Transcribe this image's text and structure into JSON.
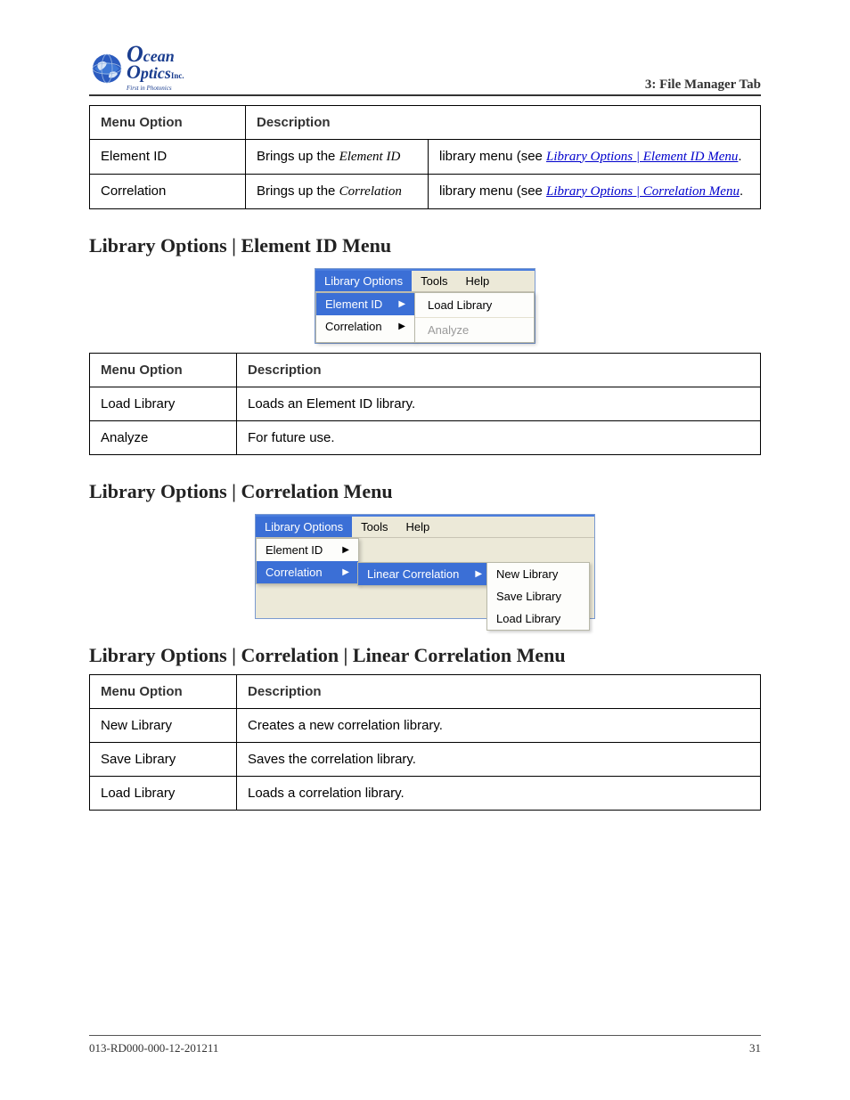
{
  "header": {
    "logo_l1": "cean",
    "logo_l2": "ptics",
    "logo_l3": "First in Photonics",
    "right": "3: File Manager Tab"
  },
  "table1": {
    "head": {
      "c1": "Menu Option",
      "c2": "Description"
    },
    "rows": [
      {
        "opt": "Element ID",
        "d1": "Brings up the ",
        "d_em": "Element ID",
        "d2": " library menu (see ",
        "link": "Library Options | Element ID Menu",
        "d3": "."
      },
      {
        "opt": "Correlation",
        "d1": "Brings up the ",
        "d_em": "Correlation",
        "d2": " library menu (see ",
        "link": "Library Options | Correlation Menu",
        "d3": "."
      }
    ]
  },
  "section1_title": "Library Options | Element ID Menu",
  "fig1": {
    "menubar": [
      "Library Options",
      "Tools",
      "Help"
    ],
    "col1": [
      {
        "label": "Element  ID",
        "sel": true
      },
      {
        "label": "Correlation",
        "sel": false
      }
    ],
    "col2": [
      {
        "label": "Load Library",
        "disabled": false
      },
      {
        "label": "Analyze",
        "disabled": true
      }
    ]
  },
  "table2": {
    "head": {
      "c1": "Menu Option",
      "c2": "Description"
    },
    "rows": [
      {
        "opt": "Load Library",
        "desc": "Loads an Element ID library."
      },
      {
        "opt": "Analyze",
        "desc": "For future use."
      }
    ]
  },
  "section2_title": "Library Options | Correlation Menu",
  "fig2": {
    "menubar": [
      "Library Options",
      "Tools",
      "Help"
    ],
    "col1": [
      {
        "label": "Element  ID",
        "sel": false
      },
      {
        "label": "Correlation",
        "sel": true
      }
    ],
    "col2": [
      {
        "label": "Linear Correlation",
        "sel": true
      }
    ],
    "col3": [
      {
        "label": "New Library"
      },
      {
        "label": "Save Library"
      },
      {
        "label": "Load Library"
      }
    ]
  },
  "section3_title": "Library Options | Correlation | Linear Correlation Menu",
  "table3": {
    "head": {
      "c1": "Menu Option",
      "c2": "Description"
    },
    "rows": [
      {
        "opt": "New Library",
        "desc": "Creates a new correlation library."
      },
      {
        "opt": "Save Library",
        "desc": "Saves the correlation library."
      },
      {
        "opt": "Load Library",
        "desc": "Loads a correlation library."
      }
    ]
  },
  "footer": {
    "left": "013-RD000-000-12-201211",
    "right": "31"
  }
}
